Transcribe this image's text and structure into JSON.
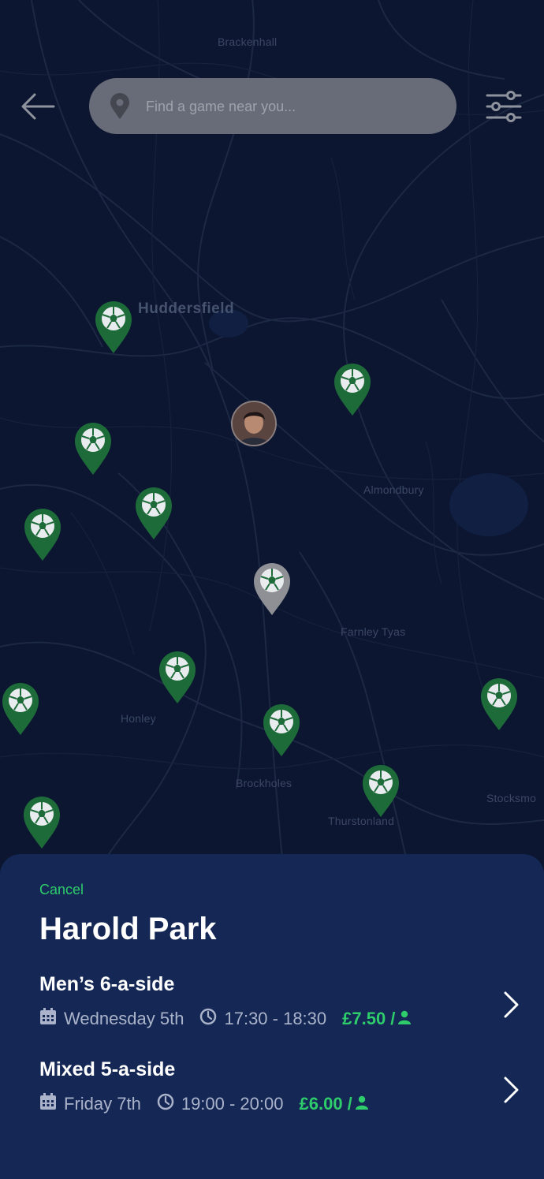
{
  "map": {
    "places": [
      {
        "name": "Brackenhall",
        "size": "small"
      },
      {
        "name": "Huddersfield",
        "size": "big"
      },
      {
        "name": "Almondbury",
        "size": "small"
      },
      {
        "name": "Farnley Tyas",
        "size": "small"
      },
      {
        "name": "Honley",
        "size": "small"
      },
      {
        "name": "Brockholes",
        "size": "small"
      },
      {
        "name": "Thurstonland",
        "size": "small"
      },
      {
        "name": "Stocksmo",
        "size": "small"
      }
    ],
    "marker_colors": {
      "game": "#1e6b3a",
      "selected": "#8e9096",
      "ball": "#e9ecef"
    }
  },
  "header": {
    "back_icon": "arrow-left-icon",
    "search_placeholder": "Find a game near you...",
    "search_icon": "location-pin-icon",
    "filter_icon": "sliders-icon"
  },
  "sheet": {
    "cancel_label": "Cancel",
    "venue_name": "Harold Park",
    "games": [
      {
        "title": "Men’s 6-a-side",
        "date": "Wednesday 5th",
        "time": "17:30 - 18:30",
        "price": "£7.50",
        "per": "/"
      },
      {
        "title": "Mixed 5-a-side",
        "date": "Friday 7th",
        "time": "19:00 - 20:00",
        "price": "£6.00",
        "per": "/"
      }
    ]
  },
  "colors": {
    "accent": "#2ecc6a",
    "sheet_bg": "#142755",
    "map_bg": "#0c1630"
  }
}
